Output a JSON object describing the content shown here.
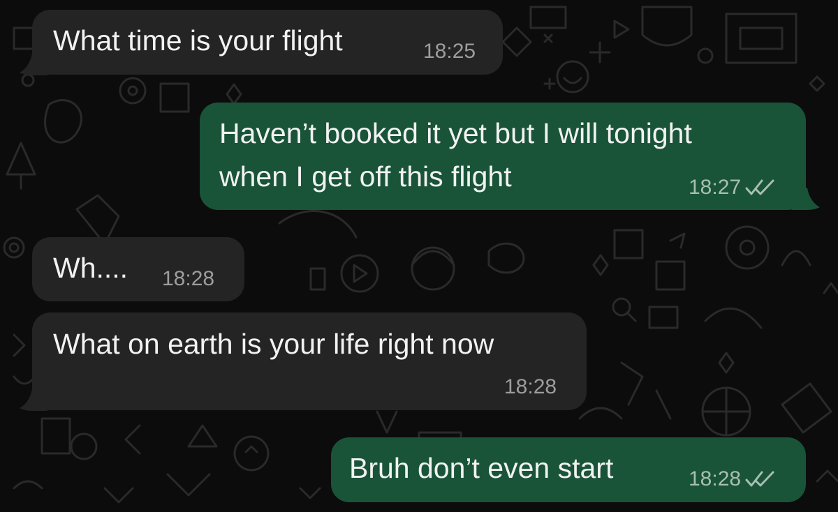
{
  "colors": {
    "background": "#0c0c0c",
    "incoming_bubble": "#242424",
    "outgoing_bubble": "#195438",
    "text": "#f2f2f2",
    "incoming_time": "#9d9d9d",
    "outgoing_time": "#a7bfb2"
  },
  "messages": [
    {
      "direction": "incoming",
      "lines": [
        "What time is your flight"
      ],
      "time": "18:25"
    },
    {
      "direction": "outgoing",
      "lines": [
        "Haven’t booked it yet but I will tonight",
        "when I get off this flight"
      ],
      "time": "18:27",
      "status_icon": "read-double-check-icon"
    },
    {
      "direction": "incoming",
      "lines": [
        "Wh...."
      ],
      "time": "18:28"
    },
    {
      "direction": "incoming",
      "lines": [
        "What on earth is your life right now"
      ],
      "time": "18:28"
    },
    {
      "direction": "outgoing",
      "lines": [
        "Bruh don’t even start"
      ],
      "time": "18:28",
      "status_icon": "read-double-check-icon"
    }
  ]
}
